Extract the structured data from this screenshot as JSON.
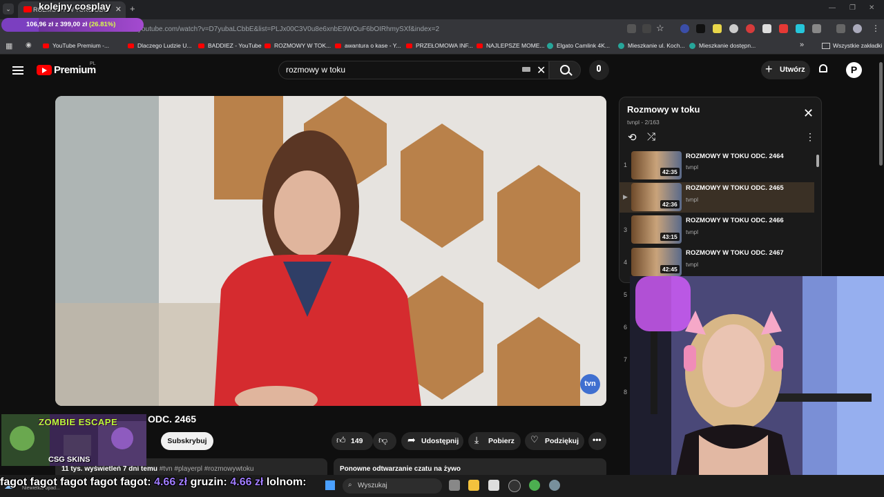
{
  "browser": {
    "tab_title": "ROZMOWY W TOKU ODC. 2465",
    "url": "youtube.com/watch?v=D7yubaLCbbE&list=PLJx00C3V0u8e6xnbE9WOuF6bOIRhmySXf&index=2",
    "bookmarks": [
      "YouTube Premium -...",
      "Dlaczego Ludzie U...",
      "BADDIEZ - YouTube",
      "ROZMOWY W TOK...",
      "awantura o kase - Y...",
      "PRZEŁOMOWA INF...",
      "NAJLEPSZE MOME...",
      "Elgato Camlink 4K...",
      "Mieszkanie ul. Koch...",
      "Mieszkanie dostępn..."
    ],
    "all_bookmarks": "Wszystkie zakładki"
  },
  "overlay": {
    "stream_title": "kolejny cosplay",
    "donation_amount": "106,96 zł",
    "donation_of": "z 399,00 zł",
    "donation_pct": "(26.81%)"
  },
  "header": {
    "brand": "Premium",
    "region": "PL",
    "search_value": "rozmowy w toku",
    "create_label": "Utwórz",
    "avatar_letter": "P"
  },
  "video": {
    "channel_bug": "tvn",
    "title": "ODC. 2465",
    "subscribe_label": "Subskrybuj",
    "likes": "149",
    "share_label": "Udostępnij",
    "download_label": "Pobierz",
    "thanks_label": "Podziękuj",
    "views": "11 tys. wyświetleń  7 dni temu",
    "tags": "#tvn #playerpl #rozmowywtoku",
    "chat_replay": "Ponowne odtwarzanie czatu na żywo"
  },
  "playlist": {
    "title": "Rozmowy w toku",
    "sub": "tvnpl - 2/163",
    "items": [
      {
        "num": "1",
        "title": "ROZMOWY W TOKU ODC. 2464",
        "channel": "tvnpl",
        "duration": "42:35"
      },
      {
        "num": "▶",
        "title": "ROZMOWY W TOKU ODC. 2465",
        "channel": "tvnpl",
        "duration": "42:36"
      },
      {
        "num": "3",
        "title": "ROZMOWY W TOKU ODC. 2466",
        "channel": "tvnpl",
        "duration": "43:15"
      },
      {
        "num": "4",
        "title": "ROZMOWY W TOKU ODC. 2467",
        "channel": "tvnpl",
        "duration": "42:45"
      }
    ],
    "extra_nums": [
      "5",
      "6",
      "7",
      "8"
    ]
  },
  "ad": {
    "game_title": "ZOMBIE ESCAPE",
    "brand": "CSG SKINS"
  },
  "ticker": {
    "n1": "fagot fagot fagot fagot fagot:",
    "a1": "4.66 zł",
    "n2": "gruzin:",
    "a2": "4.66 zł",
    "n3": "lolnom:"
  },
  "taskbar": {
    "search_label": "Wyszukaj",
    "weather": "Niewielkie opad..."
  },
  "colors": {
    "accent_red": "#ff0000",
    "donation_green": "#d9ff4a",
    "ticker_amount": "#a07cff"
  }
}
